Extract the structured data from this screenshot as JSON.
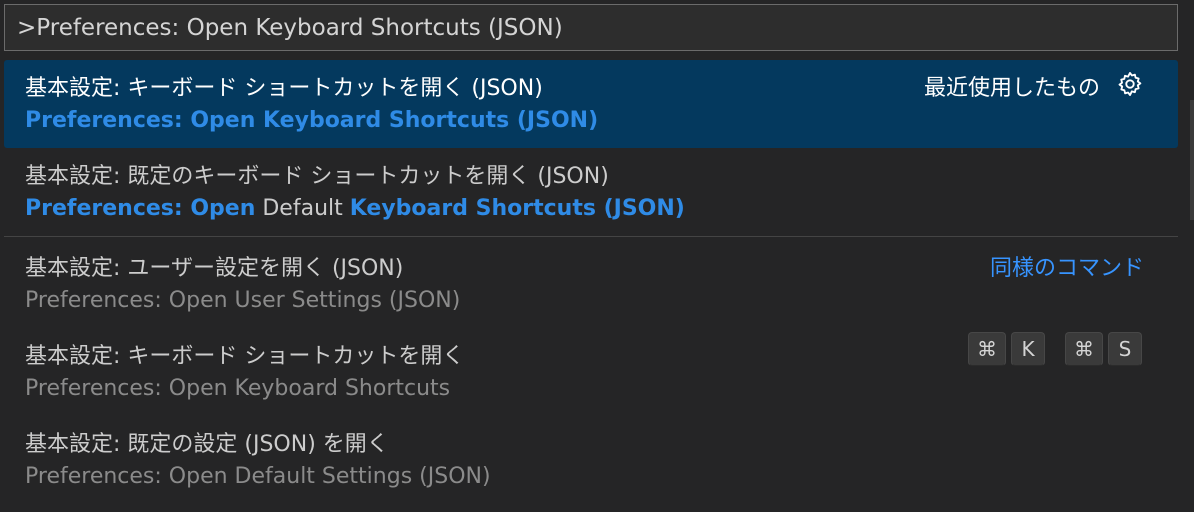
{
  "input": {
    "value": ">Preferences: Open Keyboard Shortcuts (JSON)"
  },
  "items": [
    {
      "label": "基本設定: キーボード ショートカットを開く (JSON)",
      "detail_parts": [
        {
          "text": "Preferences: Open Keyboard Shortcuts (JSON)",
          "highlight": true
        }
      ],
      "group": "最近使用したもの",
      "icon": "gear-icon"
    },
    {
      "label": "基本設定: 既定のキーボード ショートカットを開く (JSON)",
      "detail_parts": [
        {
          "text": "Preferences: Open",
          "highlight": true
        },
        {
          "text": " Default ",
          "highlight": false
        },
        {
          "text": "Keyboard Shortcuts (JSON)",
          "highlight": true
        }
      ]
    },
    {
      "label": "基本設定: ユーザー設定を開く (JSON)",
      "detail": "Preferences: Open User Settings (JSON)",
      "group": "同様のコマンド"
    },
    {
      "label": "基本設定: キーボード ショートカットを開く",
      "detail": "Preferences: Open Keyboard Shortcuts",
      "keybinding": [
        "⌘",
        "K",
        "⌘",
        "S"
      ]
    },
    {
      "label": "基本設定: 既定の設定 (JSON) を開く",
      "detail": "Preferences: Open Default Settings (JSON)"
    }
  ],
  "colors": {
    "background": "#252526",
    "selected": "#04395e",
    "highlight": "#2f8be6",
    "group_label": "#3794ff"
  }
}
